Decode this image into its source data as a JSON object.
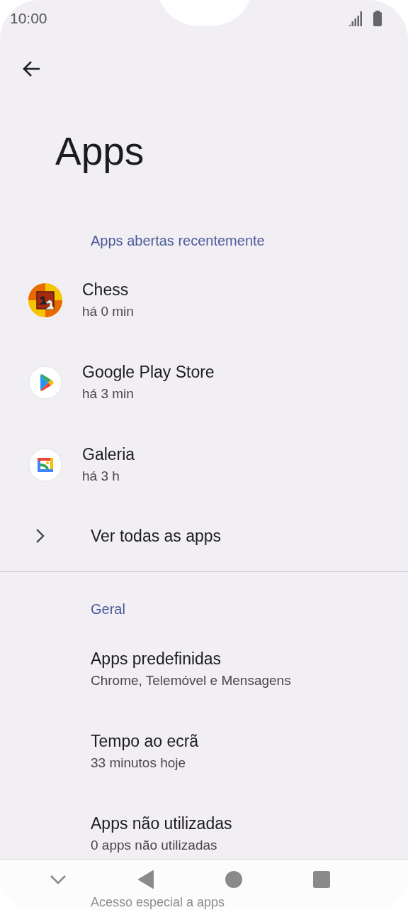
{
  "status_bar": {
    "time": "10:00"
  },
  "title": "Apps",
  "recent": {
    "header": "Apps abertas recentemente",
    "apps": [
      {
        "kind": "chess",
        "name": "Chess",
        "time": "há 0 min"
      },
      {
        "kind": "play",
        "name": "Google Play Store",
        "time": "há 3 min"
      },
      {
        "kind": "gallery",
        "name": "Galeria",
        "time": "há 3 h"
      }
    ],
    "see_all": "Ver todas as apps"
  },
  "general": {
    "header": "Geral",
    "items": [
      {
        "title": "Apps predefinidas",
        "summary": "Chrome, Telemóvel e Mensagens"
      },
      {
        "title": "Tempo ao ecrã",
        "summary": "33 minutos hoje"
      },
      {
        "title": "Apps não utilizadas",
        "summary": "0 apps não utilizadas"
      },
      {
        "title": "Acesso especial a apps"
      }
    ]
  }
}
